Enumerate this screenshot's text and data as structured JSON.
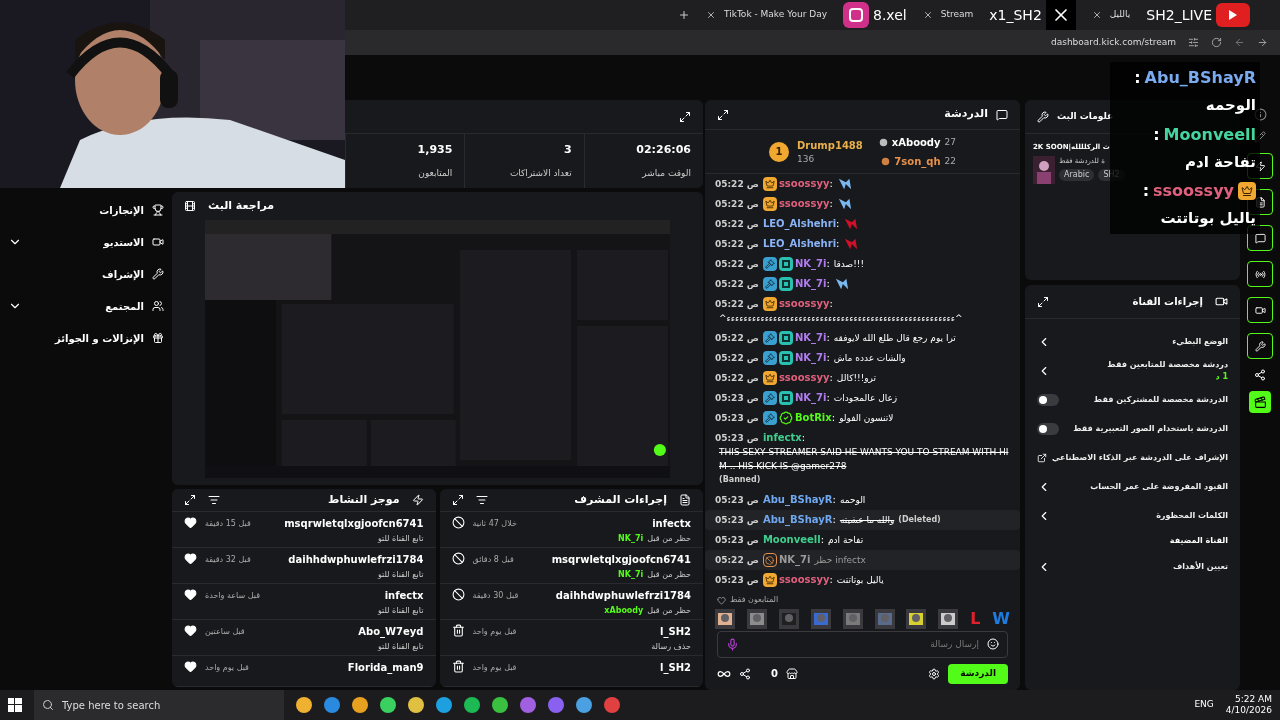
{
  "browser": {
    "tabs": [
      {
        "label": "يالليل",
        "selected": false
      },
      {
        "label": "Stream",
        "selected": false
      },
      {
        "label": "TikTok - Make Your Day",
        "selected": false
      }
    ],
    "url": "dashboard.kick.com/stream"
  },
  "overlays": {
    "instagram": "8.xel",
    "x": "x1_SH2",
    "youtube": "SH2_LIVE"
  },
  "overlay_chat": [
    {
      "user": "Abu_BShayR",
      "sep": ":",
      "color": "#7aaaf0",
      "text": "الوحمه",
      "badge": false
    },
    {
      "user": "Moonveell",
      "sep": ":",
      "color": "#45d6a0",
      "text": "تفاحة ادم",
      "badge": false
    },
    {
      "user": "ssoossyy",
      "sep": ":",
      "color": "#e0607e",
      "text": "ياليل بوتاتتت",
      "badge": true
    }
  ],
  "sidebar": [
    {
      "label": "الإنجازات",
      "kind": "link"
    },
    {
      "label": "الاستديو",
      "kind": "group"
    },
    {
      "label": "الإشراف",
      "kind": "link"
    },
    {
      "label": "المجتمع",
      "kind": "group"
    },
    {
      "label": "الإنزالات و الجوائز",
      "kind": "link"
    }
  ],
  "stats": [
    {
      "value": "02:26:06",
      "label": "الوقت مباشر"
    },
    {
      "value": "3",
      "label": "تعداد الاشتراكات"
    },
    {
      "value": "1,935",
      "label": "المتابعون"
    }
  ],
  "review": {
    "title": "مراجعة البث"
  },
  "mod_actions": {
    "title": "إجراءات المشرف",
    "items": [
      {
        "name": "infectx",
        "kind": "ban",
        "action": "حظر من قبل",
        "by": "NK_7i",
        "time": "خلال 47 ثانية"
      },
      {
        "name": "msqrwletqlxgjoofcn6741",
        "kind": "ban",
        "action": "حظر من قبل",
        "by": "NK_7i",
        "time": "قبل 8 دقائق"
      },
      {
        "name": "daihhdwphuwlefrzi1784",
        "kind": "ban",
        "action": "حظر من قبل",
        "by": "xAboody",
        "time": "قبل 30 دقيقة"
      },
      {
        "name": "l_SH2",
        "kind": "delete",
        "action": "حذف رسالة",
        "time": "قبل يوم واحد"
      },
      {
        "name": "l_SH2",
        "kind": "delete",
        "time": "قبل يوم واحد"
      }
    ]
  },
  "activity": {
    "title": "موجز النشاط",
    "items": [
      {
        "name": "msqrwletqlxgjoofcn6741",
        "action": "تابع القناة للتو",
        "time": "قبل 15 دقيقة"
      },
      {
        "name": "daihhdwphuwlefrzi1784",
        "action": "تابع القناة للتو",
        "time": "قبل 32 دقيقة"
      },
      {
        "name": "infectx",
        "action": "تابع القناة للتو",
        "time": "قبل ساعة واحدة"
      },
      {
        "name": "Abo_W7eyd",
        "action": "تابع القناة للتو",
        "time": "قبل ساعتين"
      },
      {
        "name": "Florida_man9",
        "time": "قبل يوم واحد"
      }
    ]
  },
  "chat": {
    "title": "الدردشة",
    "leaderboard": [
      {
        "name": "xAboody",
        "count": "27",
        "color": "#ffffff"
      },
      {
        "name": "7son_qh",
        "count": "22",
        "color": "#e8914a"
      },
      {
        "rank": "1",
        "name": "Drump1488",
        "count": "136",
        "color": "#e8b04a"
      }
    ],
    "messages": [
      {
        "time": "05:22 ص",
        "user": "ssoossyy",
        "sep": ":",
        "color": "#e0607e",
        "badges": [
          {
            "kind": "crown"
          }
        ],
        "kind": "emote",
        "emote": {
          "color": "#7ab8f0"
        },
        "banned": false,
        "deleted": false
      },
      {
        "time": "05:22 ص",
        "user": "ssoossyy",
        "sep": ":",
        "color": "#e0607e",
        "badges": [
          {
            "kind": "crown"
          }
        ],
        "kind": "emote",
        "emote": {
          "color": "#7ab8f0"
        },
        "banned": false,
        "deleted": false
      },
      {
        "time": "05:22 ص",
        "user": "LEO_Alshehri",
        "sep": ":",
        "color": "#8ab4f8",
        "kind": "emote",
        "emote": {
          "color": "#d0102a"
        },
        "banned": false,
        "deleted": false
      },
      {
        "time": "05:22 ص",
        "user": "LEO_Alshehri",
        "sep": ":",
        "color": "#8ab4f8",
        "kind": "emote",
        "emote": {
          "color": "#d0102a"
        },
        "banned": false,
        "deleted": false
      },
      {
        "time": "05:22 ص",
        "user": "NK_7i",
        "sep": ":",
        "color": "#b07cf0",
        "badges": [
          {
            "kind": "mod"
          },
          {
            "kind": "og"
          }
        ],
        "kind": "text",
        "text": "صدقا!!!",
        "banned": false,
        "deleted": false
      },
      {
        "time": "05:22 ص",
        "user": "NK_7i",
        "sep": ":",
        "color": "#b07cf0",
        "badges": [
          {
            "kind": "mod"
          },
          {
            "kind": "og"
          }
        ],
        "kind": "emote",
        "emote": {
          "color": "#7ab8f0"
        },
        "banned": false,
        "deleted": false
      },
      {
        "time": "05:22 ص",
        "user": "ssoossyy",
        "sep": ":",
        "color": "#e0607e",
        "badges": [
          {
            "kind": "crown"
          }
        ],
        "kind": "text",
        "text": "^ءءءءءءءءءءءءءءءءءءءءءءءءءءءءءءءءءءءءءءءءءءءءءءءءءءءءءء^",
        "banned": false,
        "deleted": false
      },
      {
        "time": "05:22 ص",
        "user": "NK_7i",
        "sep": ":",
        "color": "#b07cf0",
        "badges": [
          {
            "kind": "mod"
          },
          {
            "kind": "og"
          }
        ],
        "kind": "text",
        "text": "ترا يوم رجع قال طلع الله لايوفقه",
        "banned": false,
        "deleted": false
      },
      {
        "time": "05:22 ص",
        "user": "NK_7i",
        "sep": ":",
        "color": "#b07cf0",
        "badges": [
          {
            "kind": "mod"
          },
          {
            "kind": "og"
          }
        ],
        "kind": "text",
        "text": "والشات عدده ماش",
        "banned": false,
        "deleted": false
      },
      {
        "time": "05:22 ص",
        "user": "ssoossyy",
        "sep": ":",
        "color": "#e0607e",
        "badges": [
          {
            "kind": "crown"
          }
        ],
        "kind": "text",
        "text": "ترو!!!كالل",
        "banned": false,
        "deleted": false
      },
      {
        "time": "05:23 ص",
        "user": "NK_7i",
        "sep": ":",
        "color": "#b07cf0",
        "badges": [
          {
            "kind": "mod"
          },
          {
            "kind": "og"
          }
        ],
        "kind": "text",
        "text": "زعال عالمجودات",
        "banned": false,
        "deleted": false
      },
      {
        "time": "05:23 ص",
        "user": "BotRix",
        "sep": ":",
        "color": "#53fc18",
        "badges": [
          {
            "kind": "mod"
          },
          {
            "kind": "verified"
          }
        ],
        "kind": "text",
        "text": "لاتنسون الفولو",
        "banned": false,
        "deleted": false
      },
      {
        "time": "05:23 ص",
        "user": "infectx",
        "sep": ":",
        "color": "#3fd08f",
        "kind": "text",
        "text": "THIS SEXY STREAMER SAID HE WANTS YOU TO STREAM WITH HIM .. HIS KICK IS @gamer278",
        "banned": true,
        "deleted": false,
        "status_label": "(Banned)"
      },
      {
        "time": "05:23 ص",
        "user": "Abu_BShayR",
        "sep": ":",
        "color": "#6fa8f0",
        "kind": "text",
        "text": "الوحمه",
        "banned": false,
        "deleted": false
      },
      {
        "time": "05:23 ص",
        "user": "Abu_BShayR",
        "sep": ":",
        "color": "#6fa8f0",
        "kind": "text",
        "text": "والله ما عشيته",
        "banned": false,
        "deleted": true,
        "status_label": "(Deleted)"
      },
      {
        "time": "05:23 ص",
        "user": "Moonveell",
        "sep": ":",
        "color": "#3fd08f",
        "kind": "text",
        "text": "تفاحة ادم",
        "banned": false,
        "deleted": false
      },
      {
        "time": "05:22 ص",
        "user": "NK_7i",
        "color": "#9a9a9a",
        "badges": [
          {
            "kind": "ban"
          }
        ],
        "kind": "system",
        "text": "حظر infectx",
        "banned": false,
        "deleted": false
      },
      {
        "time": "05:23 ص",
        "user": "ssoossyy",
        "sep": ":",
        "color": "#e0607e",
        "badges": [
          {
            "kind": "crown"
          }
        ],
        "kind": "text",
        "text": "ياليل بوتاتتت",
        "banned": false,
        "deleted": false
      }
    ],
    "emotes_label": "المتابعون فقط",
    "emotes": [
      {
        "kind": "letter",
        "text": "W",
        "color": "#1e7be0"
      },
      {
        "kind": "letter",
        "text": "L",
        "color": "#e0202a"
      },
      {
        "kind": "picture"
      },
      {
        "kind": "picture"
      },
      {
        "kind": "picture"
      },
      {
        "kind": "picture"
      },
      {
        "kind": "picture"
      },
      {
        "kind": "picture"
      },
      {
        "kind": "picture"
      },
      {
        "kind": "picture"
      }
    ],
    "placeholder": "إرسال رسالة",
    "count": "0",
    "send": "الدردشة"
  },
  "stream_info": {
    "title": "علومات البث",
    "stream_title": "2K SOON|ث الركلللله",
    "category": "ة للدردشة فقط",
    "tags": [
      "SH2",
      "Arabic"
    ]
  },
  "channel_actions": {
    "title": "إجراءات القناة",
    "items": [
      {
        "kind": "link",
        "label": "الوضع البطيء"
      },
      {
        "kind": "link",
        "label": "دردشة مخصصة للمتابعين فقط",
        "sub": "1 د"
      },
      {
        "kind": "toggle",
        "label": "الدردشة مخصصة للمشتركين فقط",
        "on": false
      },
      {
        "kind": "toggle",
        "label": "الدردشة باستخدام الصور التعبيرية فقط",
        "on": false
      },
      {
        "kind": "external",
        "label": "الإشراف على الدردشة عبر الذكاء الاصطناعي"
      },
      {
        "kind": "link",
        "label": "القيود المفروضة على عمر الحساب"
      },
      {
        "kind": "link",
        "label": "الكلمات المحظورة"
      },
      {
        "kind": "heading",
        "label": "القناة المضيفة"
      },
      {
        "kind": "link",
        "label": "تعيين الأهداف"
      }
    ]
  },
  "taskbar": {
    "search": "Type here to search",
    "lang": "ENG",
    "time": "5:22 AM",
    "date": "4/10/2026"
  }
}
